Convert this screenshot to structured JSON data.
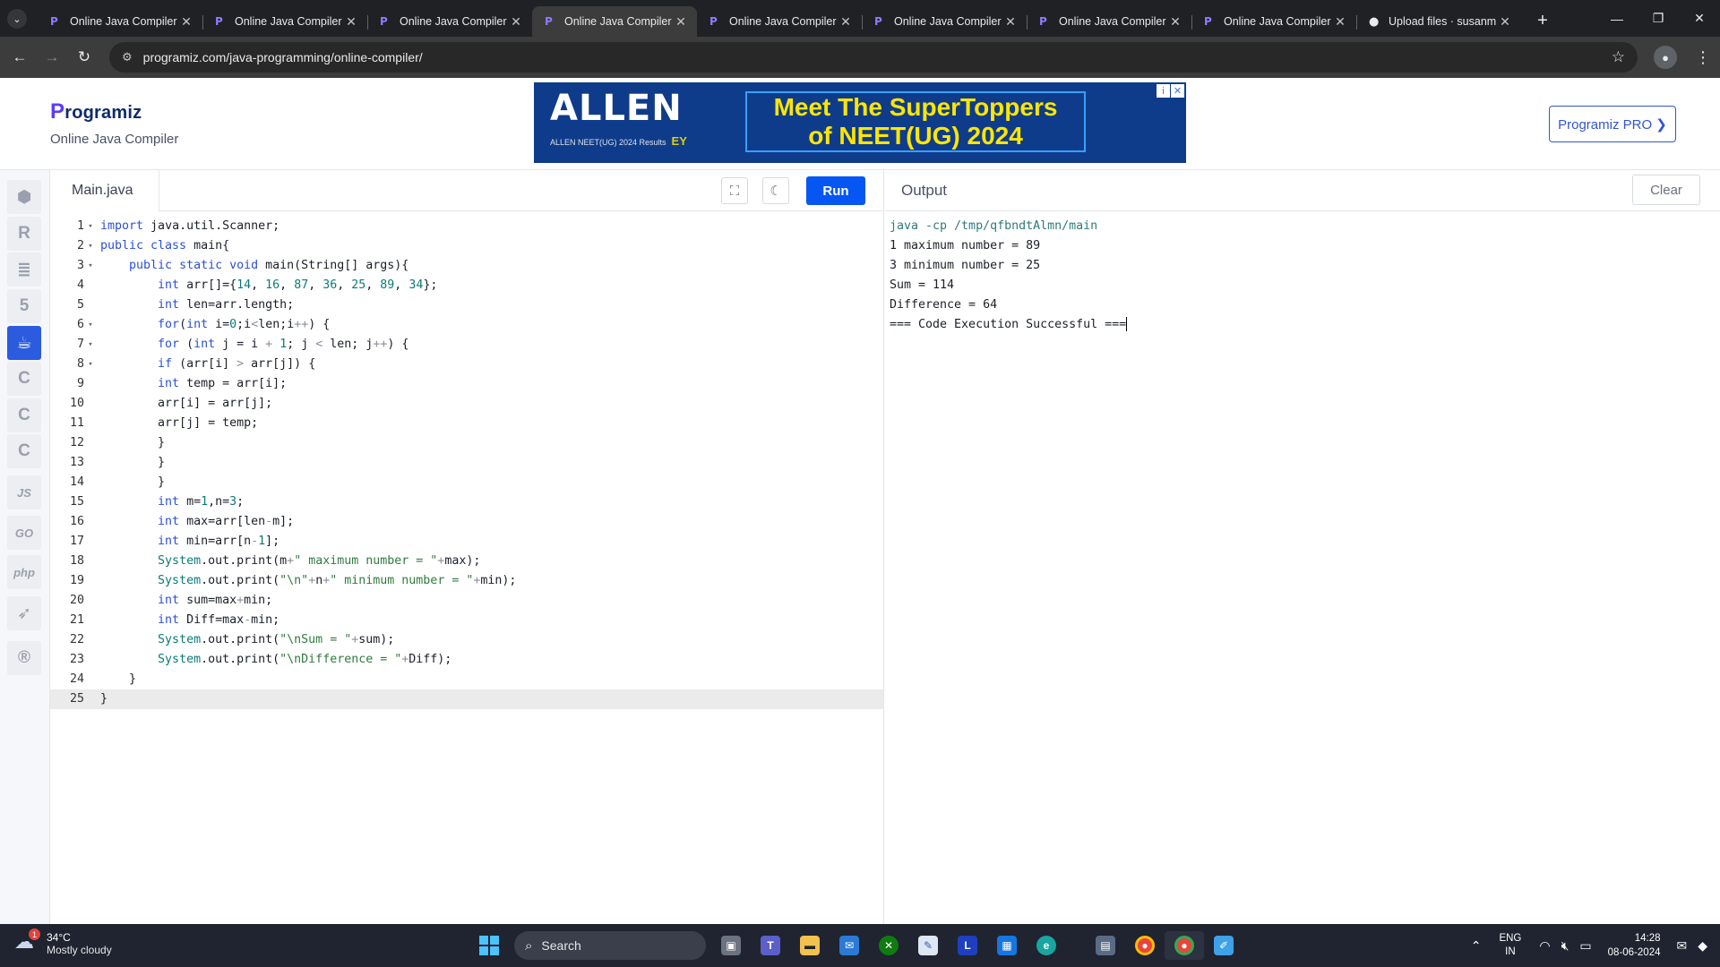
{
  "browser": {
    "tabs": [
      {
        "title": "Online Java Compiler",
        "active": false
      },
      {
        "title": "Online Java Compiler",
        "active": false
      },
      {
        "title": "Online Java Compiler",
        "active": false
      },
      {
        "title": "Online Java Compiler",
        "active": true
      },
      {
        "title": "Online Java Compiler",
        "active": false
      },
      {
        "title": "Online Java Compiler",
        "active": false
      },
      {
        "title": "Online Java Compiler",
        "active": false
      },
      {
        "title": "Online Java Compiler",
        "active": false
      },
      {
        "title": "Upload files · susanm",
        "active": false
      }
    ],
    "url": "programiz.com/java-programming/online-compiler/"
  },
  "header": {
    "logo_text": "rogramiz",
    "logo_initial": "P",
    "subtitle": "Online Java Compiler",
    "pro_button": "Programiz PRO ❯"
  },
  "ad": {
    "brand": "ALLEN",
    "tagline_line1": "Meet The SuperToppers",
    "tagline_line2": "of NEET(UG) 2024",
    "sub": "ALLEN NEET(UG) 2024 Results",
    "partner": "EY"
  },
  "rail": {
    "languages": [
      "python",
      "r",
      "sql",
      "html",
      "java",
      "c",
      "cpp",
      "csharp",
      "JS",
      "GO",
      "php",
      "swift",
      "rust"
    ],
    "active": "java"
  },
  "editor": {
    "filename": "Main.java",
    "run_label": "Run",
    "current_line": 25
  },
  "output": {
    "title": "Output",
    "clear_label": "Clear",
    "lines": [
      "java -cp /tmp/qfbndtAlmn/main",
      "1 maximum number = 89",
      "3 minimum number = 25",
      "Sum = 114",
      "Difference = 64",
      "=== Code Execution Successful ==="
    ]
  },
  "taskbar": {
    "temperature": "34°C",
    "weather": "Mostly cloudy",
    "weather_badge": "1",
    "search_placeholder": "Search",
    "lang_line1": "ENG",
    "lang_line2": "IN",
    "time": "14:28",
    "date": "08-06-2024"
  }
}
